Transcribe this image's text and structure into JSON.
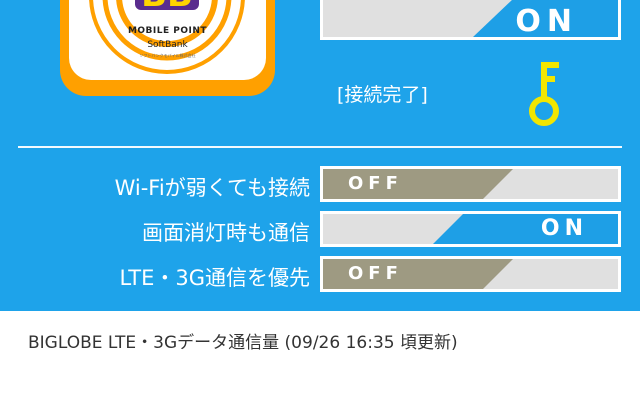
{
  "header": {
    "logo": {
      "badge_text": "BB",
      "line1": "MOBILE POINT",
      "line2": "SoftBank",
      "line3": "ソフトバンクモバイル株式会社"
    },
    "main_toggle": {
      "state": "ON"
    },
    "connection_status": "[接続完了]",
    "key_icon": "key-icon"
  },
  "settings": [
    {
      "label": "Wi-Fiが弱くても接続",
      "state": "OFF"
    },
    {
      "label": "画面消灯時も通信",
      "state": "ON"
    },
    {
      "label": "LTE・3G通信を優先",
      "state": "OFF"
    }
  ],
  "footer": {
    "usage_title": "BIGLOBE LTE・3Gデータ通信量 (09/26 16:35 頃更新)"
  },
  "colors": {
    "panel_bg": "#1ea3ea",
    "on_fill": "#1e9fe6",
    "off_fill": "#9e9a82",
    "toggle_bg": "#e0e0e0",
    "key": "#f2e600",
    "icon_frame": "#ffa000",
    "logo_purple": "#5a2c8e"
  }
}
